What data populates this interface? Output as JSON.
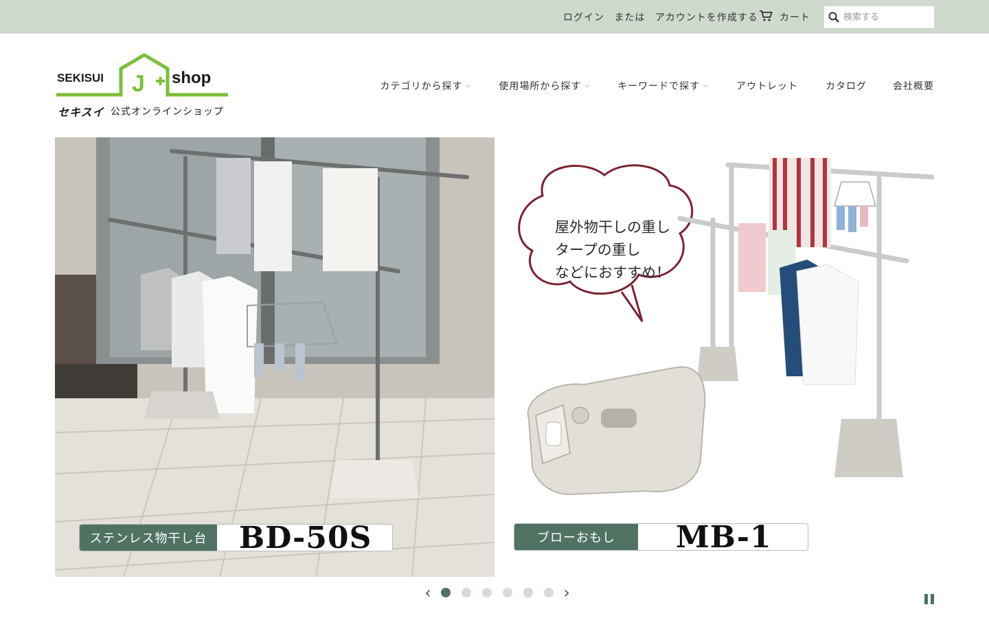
{
  "topbar": {
    "login": "ログイン",
    "or": "または",
    "create_account": "アカウントを作成する",
    "cart": "カート",
    "search_placeholder": "検索する"
  },
  "logo": {
    "brand_left": "SEKISUI",
    "brand_letter": "J",
    "brand_right": "shop",
    "sub_left": "セキスイ",
    "sub_right": "公式オンラインショップ",
    "accent_color": "#7bbf3a"
  },
  "nav": {
    "items": [
      {
        "label": "カテゴリから探す",
        "dropdown": true
      },
      {
        "label": "使用場所から探す",
        "dropdown": true
      },
      {
        "label": "キーワードで探す",
        "dropdown": true
      },
      {
        "label": "アウトレット",
        "dropdown": false
      },
      {
        "label": "カタログ",
        "dropdown": false
      },
      {
        "label": "会社概要",
        "dropdown": false
      }
    ]
  },
  "slides": [
    {
      "tag": "ステンレス物干し台",
      "model": "BD-50S"
    },
    {
      "tag": "ブローおもし",
      "model": "MB-1",
      "bubble_lines": [
        "屋外物干しの重し",
        "タープの重し",
        "などにおすすめ！"
      ]
    }
  ],
  "slider": {
    "dot_count": 6,
    "active_dot": 1,
    "prev": "‹",
    "next": "›"
  },
  "colors": {
    "topbar_bg": "#cfd9ce",
    "accent": "#4f7263",
    "bubble_border": "#7a2230"
  }
}
